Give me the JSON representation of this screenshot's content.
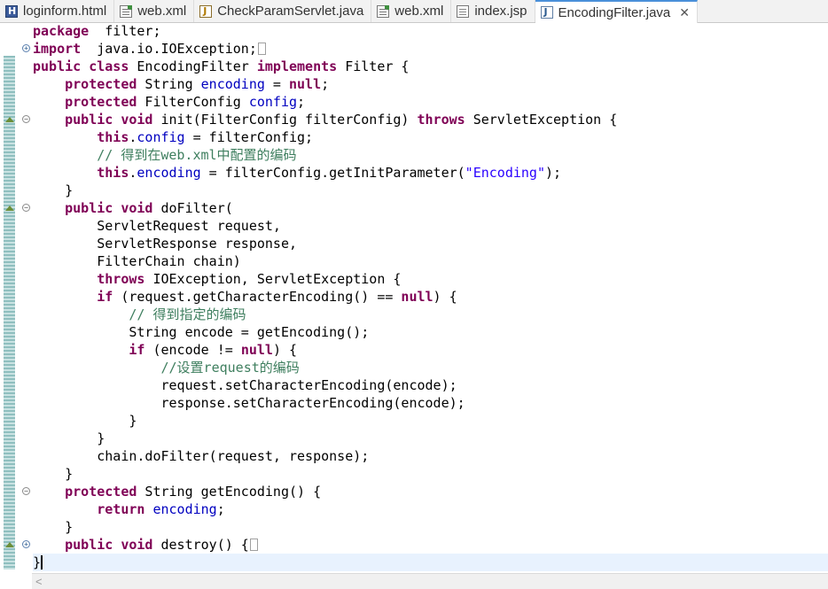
{
  "tabs": [
    {
      "label": "loginform.html",
      "icon": "html-file-icon",
      "active": false
    },
    {
      "label": "web.xml",
      "icon": "xml-file-icon",
      "active": false
    },
    {
      "label": "CheckParamServlet.java",
      "icon": "java-file-icon",
      "active": false
    },
    {
      "label": "web.xml",
      "icon": "xml-file-icon",
      "active": false
    },
    {
      "label": "index.jsp",
      "icon": "jsp-file-icon",
      "active": false
    },
    {
      "label": "EncodingFilter.java",
      "icon": "java-file-icon",
      "active": true
    }
  ],
  "close_glyph": "✕",
  "scroll_left_glyph": "<",
  "code_lines": [
    [
      [
        "kw",
        "package"
      ],
      [
        "",
        "  filter;"
      ]
    ],
    [
      [
        "kw",
        "import"
      ],
      [
        "",
        "  java.io.IOException;"
      ],
      [
        "fold",
        ""
      ]
    ],
    [
      [
        "kw",
        "public"
      ],
      [
        "",
        " "
      ],
      [
        "kw",
        "class"
      ],
      [
        "",
        " EncodingFilter "
      ],
      [
        "kw",
        "implements"
      ],
      [
        "",
        " Filter {"
      ]
    ],
    [
      [
        "",
        "    "
      ],
      [
        "kw",
        "protected"
      ],
      [
        "",
        " String "
      ],
      [
        "fld",
        "encoding"
      ],
      [
        "",
        " = "
      ],
      [
        "kw",
        "null"
      ],
      [
        "",
        ";"
      ]
    ],
    [
      [
        "",
        "    "
      ],
      [
        "kw",
        "protected"
      ],
      [
        "",
        " FilterConfig "
      ],
      [
        "fld",
        "config"
      ],
      [
        "",
        ";"
      ]
    ],
    [
      [
        "",
        "    "
      ],
      [
        "kw",
        "public"
      ],
      [
        "",
        " "
      ],
      [
        "kw",
        "void"
      ],
      [
        "",
        " init(FilterConfig filterConfig) "
      ],
      [
        "kw",
        "throws"
      ],
      [
        "",
        " ServletException {"
      ]
    ],
    [
      [
        "",
        "        "
      ],
      [
        "kw",
        "this"
      ],
      [
        "",
        "."
      ],
      [
        "fld",
        "config"
      ],
      [
        "",
        " = filterConfig;"
      ]
    ],
    [
      [
        "",
        "        "
      ],
      [
        "cmt",
        "// 得到在web.xml中配置的编码"
      ]
    ],
    [
      [
        "",
        "        "
      ],
      [
        "kw",
        "this"
      ],
      [
        "",
        "."
      ],
      [
        "fld",
        "encoding"
      ],
      [
        "",
        " = filterConfig.getInitParameter("
      ],
      [
        "str",
        "\"Encoding\""
      ],
      [
        "",
        ");"
      ]
    ],
    [
      [
        "",
        "    }"
      ]
    ],
    [
      [
        "",
        "    "
      ],
      [
        "kw",
        "public"
      ],
      [
        "",
        " "
      ],
      [
        "kw",
        "void"
      ],
      [
        "",
        " doFilter("
      ]
    ],
    [
      [
        "",
        "        ServletRequest request,"
      ]
    ],
    [
      [
        "",
        "        ServletResponse response,"
      ]
    ],
    [
      [
        "",
        "        FilterChain chain)"
      ]
    ],
    [
      [
        "",
        "        "
      ],
      [
        "kw",
        "throws"
      ],
      [
        "",
        " IOException, ServletException {"
      ]
    ],
    [
      [
        "",
        "        "
      ],
      [
        "kw",
        "if"
      ],
      [
        "",
        " (request.getCharacterEncoding() == "
      ],
      [
        "kw",
        "null"
      ],
      [
        "",
        ") {"
      ]
    ],
    [
      [
        "",
        "            "
      ],
      [
        "cmt",
        "// 得到指定的编码"
      ]
    ],
    [
      [
        "",
        "            String encode = getEncoding();"
      ]
    ],
    [
      [
        "",
        "            "
      ],
      [
        "kw",
        "if"
      ],
      [
        "",
        " (encode != "
      ],
      [
        "kw",
        "null"
      ],
      [
        "",
        ") {"
      ]
    ],
    [
      [
        "",
        "                "
      ],
      [
        "cmt",
        "//设置request的编码"
      ]
    ],
    [
      [
        "",
        "                request.setCharacterEncoding(encode);"
      ]
    ],
    [
      [
        "",
        "                response.setCharacterEncoding(encode);"
      ]
    ],
    [
      [
        "",
        "            }"
      ]
    ],
    [
      [
        "",
        "        }"
      ]
    ],
    [
      [
        "",
        "        chain.doFilter(request, response);"
      ]
    ],
    [
      [
        "",
        "    }"
      ]
    ],
    [
      [
        "",
        "    "
      ],
      [
        "kw",
        "protected"
      ],
      [
        "",
        " String getEncoding() {"
      ]
    ],
    [
      [
        "",
        "        "
      ],
      [
        "kw",
        "return"
      ],
      [
        "",
        " "
      ],
      [
        "fld",
        "encoding"
      ],
      [
        "",
        ";"
      ]
    ],
    [
      [
        "",
        "    }"
      ]
    ],
    [
      [
        "",
        "    "
      ],
      [
        "kw",
        "public"
      ],
      [
        "",
        " "
      ],
      [
        "kw",
        "void"
      ],
      [
        "",
        " destroy() {"
      ],
      [
        "fold",
        ""
      ]
    ],
    [
      [
        "",
        "}"
      ],
      [
        "caret",
        ""
      ]
    ]
  ],
  "fold_markers": [
    {
      "line": 1,
      "type": "expand"
    },
    {
      "line": 5,
      "type": "collapse"
    },
    {
      "line": 10,
      "type": "collapse"
    },
    {
      "line": 26,
      "type": "collapse"
    },
    {
      "line": 29,
      "type": "expand"
    }
  ],
  "override_markers": [
    5,
    10,
    29
  ],
  "current_line": 30,
  "colors": {
    "keyword": "#7f0055",
    "field": "#0000c0",
    "comment": "#3f7f5f",
    "string": "#2a00ff",
    "current_line": "#e8f2fe"
  }
}
